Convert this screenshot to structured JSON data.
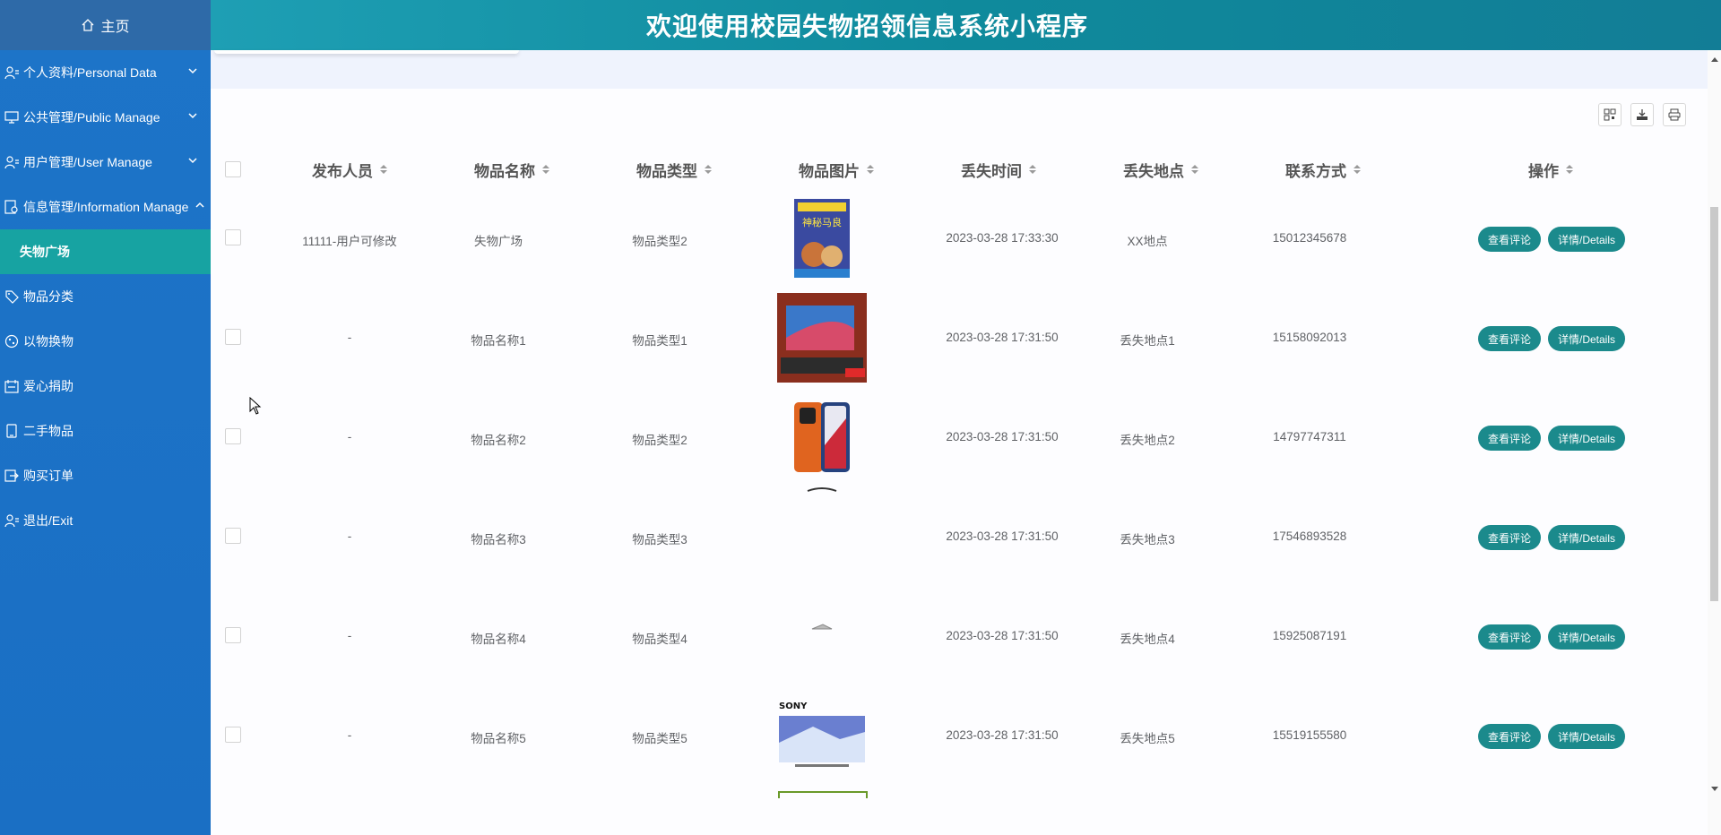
{
  "header": {
    "title": "欢迎使用校园失物招领信息系统小程序"
  },
  "sidebar": {
    "home": "主页",
    "items": [
      {
        "label": "个人资料/Personal Data",
        "icon": "user-icon",
        "has_chevron": true
      },
      {
        "label": "公共管理/Public Manage",
        "icon": "monitor-icon",
        "has_chevron": true
      },
      {
        "label": "用户管理/User Manage",
        "icon": "user-icon",
        "has_chevron": true
      },
      {
        "label": "信息管理/Information Manage",
        "icon": "settings-doc-icon",
        "has_chevron": true
      },
      {
        "label": "失物广场",
        "icon": "",
        "active": true
      },
      {
        "label": "物品分类",
        "icon": "tag-icon"
      },
      {
        "label": "以物换物",
        "icon": "exchange-icon"
      },
      {
        "label": "爱心捐助",
        "icon": "calendar-icon"
      },
      {
        "label": "二手物品",
        "icon": "phone-icon"
      },
      {
        "label": "购买订单",
        "icon": "logout-box-icon"
      },
      {
        "label": "退出/Exit",
        "icon": "user-icon"
      }
    ]
  },
  "table": {
    "headers": [
      "发布人员",
      "物品名称",
      "物品类型",
      "物品图片",
      "丢失时间",
      "丢失地点",
      "联系方式",
      "操作"
    ],
    "rows": [
      {
        "publisher": "11111-用户可修改",
        "name": "失物广场",
        "type": "物品类型2",
        "image": "book-cover",
        "time": "2023-03-28 17:33:30",
        "place": "XX地点",
        "contact": "15012345678"
      },
      {
        "publisher": "-",
        "name": "物品名称1",
        "type": "物品类型1",
        "image": "laptop",
        "time": "2023-03-28 17:31:50",
        "place": "丢失地点1",
        "contact": "15158092013"
      },
      {
        "publisher": "-",
        "name": "物品名称2",
        "type": "物品类型2",
        "image": "orange-phone",
        "time": "2023-03-28 17:31:50",
        "place": "丢失地点2",
        "contact": "14797747311"
      },
      {
        "publisher": "-",
        "name": "物品名称3",
        "type": "物品类型3",
        "image": "small-item",
        "time": "2023-03-28 17:31:50",
        "place": "丢失地点3",
        "contact": "17546893528"
      },
      {
        "publisher": "-",
        "name": "物品名称4",
        "type": "物品类型4",
        "image": "small-item-2",
        "time": "2023-03-28 17:31:50",
        "place": "丢失地点4",
        "contact": "15925087191"
      },
      {
        "publisher": "-",
        "name": "物品名称5",
        "type": "物品类型5",
        "image": "sony-tv",
        "time": "2023-03-28 17:31:50",
        "place": "丢失地点5",
        "contact": "15519155580"
      }
    ],
    "actions": {
      "comment": "查看评论",
      "details": "详情/Details"
    }
  },
  "image_labels": {
    "brand": "SONY",
    "book_title": "神秘马良"
  },
  "colors": {
    "sidebar": "#1a6fc4",
    "header": "#0f8a9c",
    "active": "#17a3a2",
    "button": "#1b8a8c"
  }
}
